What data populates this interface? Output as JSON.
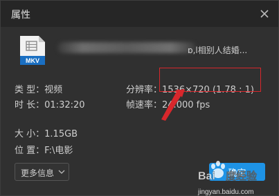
{
  "window": {
    "title": "属性",
    "close_icon": "close-icon"
  },
  "file": {
    "icon": "video-file-icon",
    "icon_label": "MKV",
    "name_visible": "ɒ,ⅼ相别人结婚..."
  },
  "info": {
    "type_key": "类 型：",
    "type_value": "视频",
    "duration_key": "时 长：",
    "duration_value": "01:32:20",
    "resolution_key": "分辨率：",
    "resolution_value": "1536×720 (1.78 : 1)",
    "framerate_key": "帧速率：",
    "framerate_value": "24.000 fps",
    "size_key": "大 小：",
    "size_value": "1.15GB",
    "location_key": "位 置：",
    "location_value": "F:\\电影"
  },
  "buttons": {
    "more_label": "更多信息",
    "confirm_label": "确定"
  },
  "watermark": {
    "text": "Bai度经验",
    "url": "jingyan.baidu.com"
  },
  "colors": {
    "dialog_bg": "#303030",
    "titlebar_bg": "#262626",
    "accent": "#1e93e6",
    "highlight": "#d8272c",
    "mkv_badge": "#1a6fc2"
  }
}
